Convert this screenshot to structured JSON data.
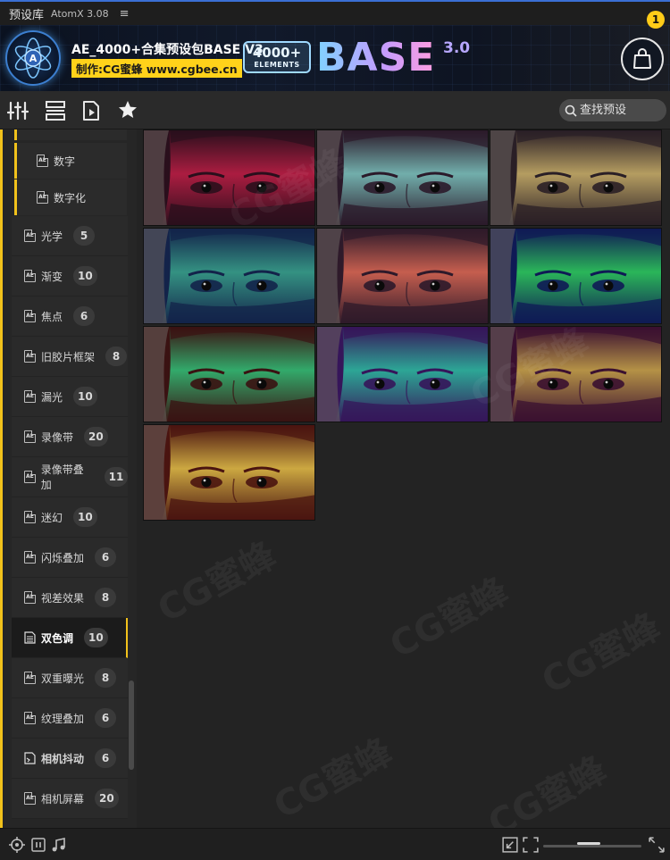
{
  "titlebar": {
    "app_name": "预设库",
    "version": "AtomX 3.08",
    "menu_glyph": "≡"
  },
  "banner": {
    "title": "AE_4000+合集预设包BASE V3",
    "subtitle": "制作:CG蜜蜂 www.cgbee.cn",
    "big_count": "4000+",
    "big_elements": "ELEMENTS",
    "big_word": "BASE",
    "big_version": "3.0",
    "cart_badge": "1",
    "logo_letter": "A"
  },
  "toolbar": {
    "search_placeholder": "查找预设",
    "icons": [
      "sliders-icon",
      "list-icon",
      "play-file-icon",
      "star-icon"
    ]
  },
  "sidebar": {
    "subitems": [
      {
        "label": "数字"
      },
      {
        "label": "数字化"
      }
    ],
    "items": [
      {
        "label": "光学",
        "count": "5"
      },
      {
        "label": "渐变",
        "count": "10"
      },
      {
        "label": "焦点",
        "count": "6"
      },
      {
        "label": "旧胶片框架",
        "count": "8"
      },
      {
        "label": "漏光",
        "count": "10"
      },
      {
        "label": "录像带",
        "count": "20"
      },
      {
        "label": "录像带叠加",
        "count": "11"
      },
      {
        "label": "迷幻",
        "count": "10"
      },
      {
        "label": "闪烁叠加",
        "count": "6"
      },
      {
        "label": "视差效果",
        "count": "8"
      },
      {
        "label": "双色调",
        "count": "10"
      },
      {
        "label": "双重曝光",
        "count": "8"
      },
      {
        "label": "纹理叠加",
        "count": "6"
      },
      {
        "label": "相机抖动",
        "count": "6"
      },
      {
        "label": "相机屏幕",
        "count": "20"
      }
    ]
  },
  "gallery": {
    "thumbnails": [
      {
        "shadow": "#2a0f1c",
        "highlight": "#c21f47"
      },
      {
        "shadow": "#2b1a2a",
        "highlight": "#7ec8c2"
      },
      {
        "shadow": "#2a1f26",
        "highlight": "#cdb36b"
      },
      {
        "shadow": "#13234a",
        "highlight": "#3aa58c"
      },
      {
        "shadow": "#2e1a2a",
        "highlight": "#e06a55"
      },
      {
        "shadow": "#0f1a55",
        "highlight": "#2fd15a"
      },
      {
        "shadow": "#3a1212",
        "highlight": "#31c47a"
      },
      {
        "shadow": "#36155a",
        "highlight": "#2bbfa0"
      },
      {
        "shadow": "#3a1030",
        "highlight": "#caa84a"
      },
      {
        "shadow": "#4a1410",
        "highlight": "#e3c24a"
      }
    ]
  },
  "watermark": {
    "text": "CG蜜蜂",
    "url": "www.cgbee.cn"
  },
  "bottombar": {
    "icons": [
      "target-icon",
      "pause-icon",
      "music-icon",
      "shrink-icon",
      "expand-icon"
    ],
    "zoom_fraction": 0.45
  },
  "colors": {
    "accent": "#f2c21b",
    "banner_blue": "#3c7fd0",
    "panel_bg": "#232323"
  }
}
